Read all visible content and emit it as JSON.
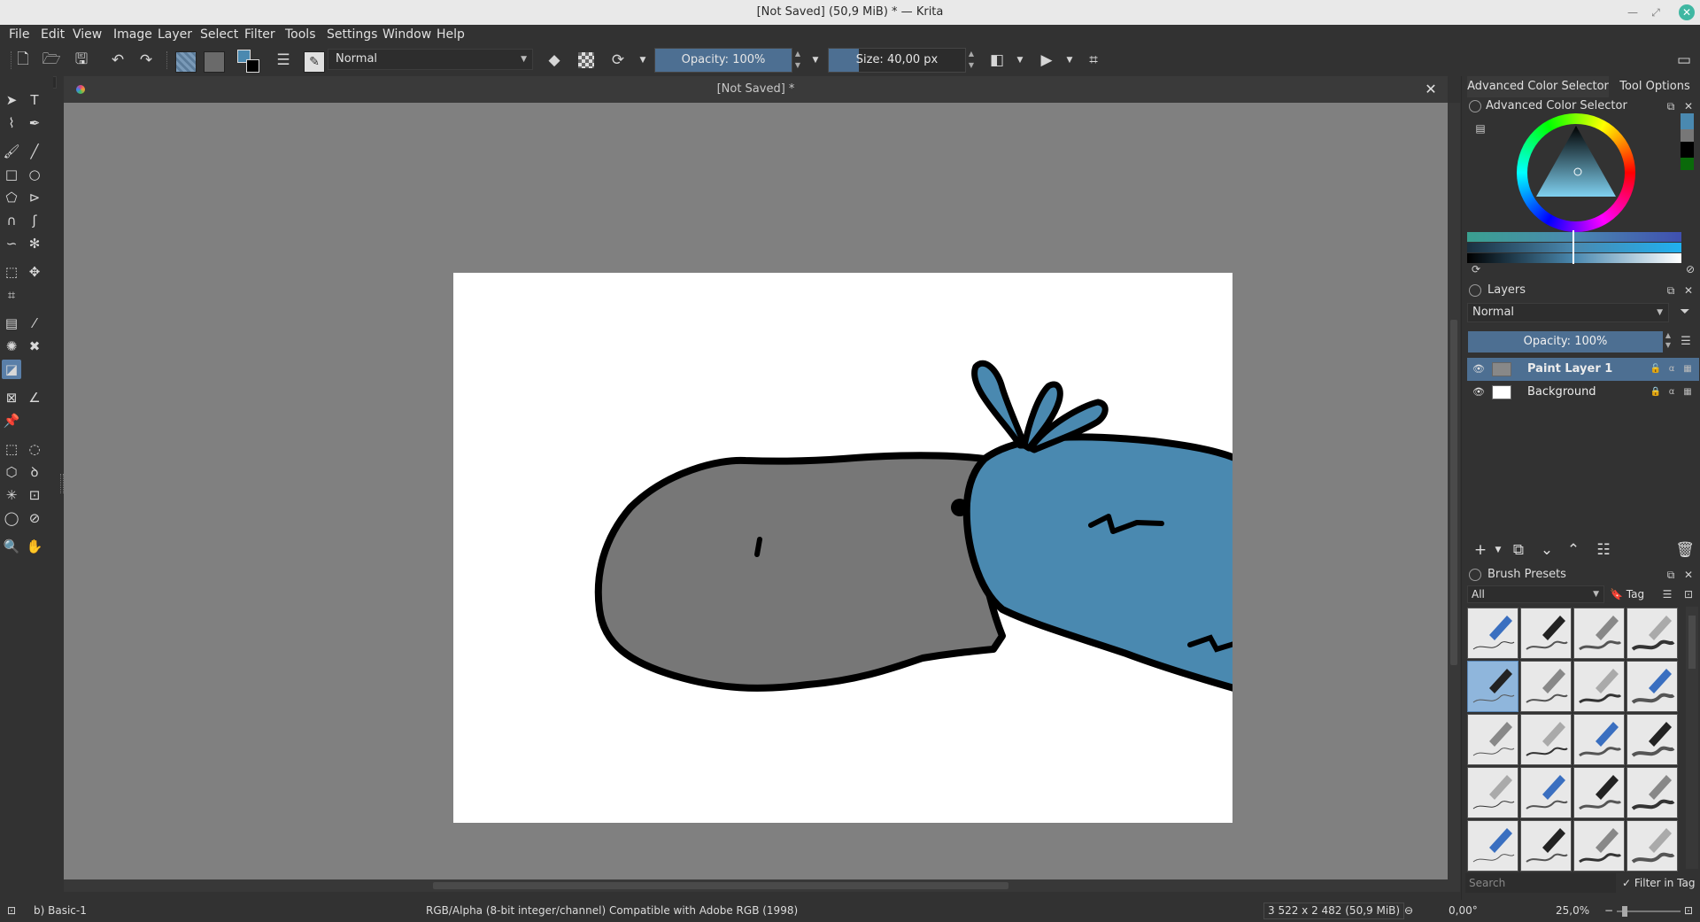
{
  "window": {
    "title": "[Not Saved]  (50,9 MiB)  * — Krita"
  },
  "menu": [
    "File",
    "Edit",
    "View",
    "Image",
    "Layer",
    "Select",
    "Filter",
    "Tools",
    "Settings",
    "Window",
    "Help"
  ],
  "toolbar": {
    "blend_mode": "Normal",
    "opacity_label": "Opacity: 100%",
    "opacity_value": 1.0,
    "size_label": "Size: 40,00 px",
    "fg_color": "#4a89b0",
    "bg_color": "#000000"
  },
  "document": {
    "tab_title": "[Not Saved]  *"
  },
  "docker": {
    "tabs": [
      "Advanced Color Selector",
      "Tool Options"
    ],
    "color_selector_title": "Advanced Color Selector",
    "layers_title": "Layers",
    "layers_blend": "Normal",
    "layers_opacity": "Opacity:  100%",
    "layers": [
      {
        "name": "Paint Layer 1",
        "selected": true
      },
      {
        "name": "Background",
        "selected": false
      }
    ],
    "brush_presets_title": "Brush Presets",
    "brush_filter": "All",
    "brush_tag_label": "Tag",
    "brush_search_placeholder": "Search",
    "filter_in_tag_label": "Filter in Tag"
  },
  "status": {
    "brush_name": "b) Basic-1",
    "color_profile": "RGB/Alpha (8-bit integer/channel)  Compatible with Adobe RGB (1998)",
    "image_size": "3 522 x 2 482 (50,9 MiB)",
    "rotation": "0,00°",
    "zoom": "25,0%"
  },
  "colors": {
    "accent": "#4d6f92",
    "creature_gray": "#777777",
    "creature_blue": "#4a89b0",
    "canvas_bg": "#808080"
  }
}
